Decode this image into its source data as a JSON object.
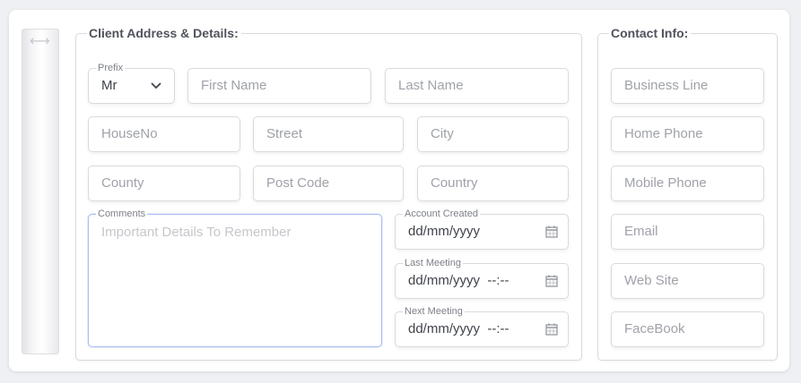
{
  "client": {
    "legend": "Client Address & Details:",
    "prefix_label": "Prefix",
    "prefix_value": "Mr",
    "first_name_placeholder": "First Name",
    "last_name_placeholder": "Last Name",
    "houseno_placeholder": "HouseNo",
    "street_placeholder": "Street",
    "city_placeholder": "City",
    "county_placeholder": "County",
    "postcode_placeholder": "Post Code",
    "country_placeholder": "Country",
    "comments_label": "Comments",
    "comments_placeholder": "Important Details To Remember",
    "account_created_label": "Account Created",
    "account_created_value": "dd/mm/yyyy",
    "last_meeting_label": "Last Meeting",
    "last_meeting_value": "dd/mm/yyyy  --:--",
    "next_meeting_label": "Next Meeting",
    "next_meeting_value": "dd/mm/yyyy  --:--"
  },
  "contact": {
    "legend": "Contact Info:",
    "business_line_placeholder": "Business Line",
    "home_phone_placeholder": "Home Phone",
    "mobile_phone_placeholder": "Mobile Phone",
    "email_placeholder": "Email",
    "web_site_placeholder": "Web Site",
    "facebook_placeholder": "FaceBook"
  },
  "icons": {
    "handle": "resize-arrow-icon",
    "prefix": "chevron-down-icon",
    "date": "calendar-icon"
  },
  "colors": {
    "focus_border": "#aabcf2",
    "border": "#d9dadf",
    "background": "#eff0f3"
  }
}
